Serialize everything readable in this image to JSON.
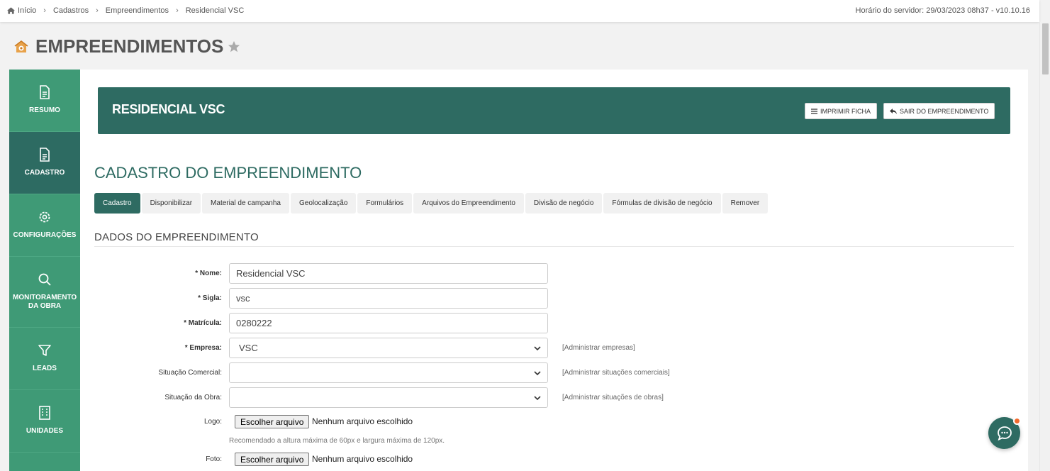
{
  "breadcrumb": {
    "items": [
      "Início",
      "Cadastros",
      "Empreendimentos",
      "Residencial VSC"
    ]
  },
  "server_time": "Horário do servidor: 29/03/2023 08h37 - v10.10.16",
  "page": {
    "title": "EMPREENDIMENTOS",
    "icons": {
      "title": "building-gear-icon",
      "favorite": "star-icon"
    }
  },
  "sidebar": {
    "items": [
      {
        "label": "RESUMO",
        "icon": "document-icon",
        "active": false
      },
      {
        "label": "CADASTRO",
        "icon": "document-icon",
        "active": true
      },
      {
        "label": "CONFIGURAÇÕES",
        "icon": "gear-icon",
        "active": false
      },
      {
        "label": "MONITORAMENTO DA OBRA",
        "icon": "search-icon",
        "active": false
      },
      {
        "label": "LEADS",
        "icon": "filter-icon",
        "active": false
      },
      {
        "label": "UNIDADES",
        "icon": "building-icon",
        "active": false
      }
    ]
  },
  "header": {
    "title": "RESIDENCIAL VSC",
    "print_label": "IMPRIMIR FICHA",
    "exit_label": "SAIR DO EMPREENDIMENTO"
  },
  "section": {
    "title": "CADASTRO DO EMPREENDIMENTO",
    "subsection": "DADOS DO EMPREENDIMENTO"
  },
  "tabs": [
    {
      "label": "Cadastro",
      "active": true
    },
    {
      "label": "Disponibilizar",
      "active": false
    },
    {
      "label": "Material de campanha",
      "active": false
    },
    {
      "label": "Geolocalização",
      "active": false
    },
    {
      "label": "Formulários",
      "active": false
    },
    {
      "label": "Arquivos do Empreendimento",
      "active": false
    },
    {
      "label": "Divisão de negócio",
      "active": false
    },
    {
      "label": "Fórmulas de divisão de negócio",
      "active": false
    },
    {
      "label": "Remover",
      "active": false
    }
  ],
  "form": {
    "nome": {
      "label": "* Nome:",
      "value": "Residencial VSC"
    },
    "sigla": {
      "label": "* Sigla:",
      "value": "vsc"
    },
    "matricula": {
      "label": "* Matrícula:",
      "value": "0280222"
    },
    "empresa": {
      "label": "* Empresa:",
      "value": "VSC",
      "link": "[Administrar empresas]"
    },
    "situacao_comercial": {
      "label": "Situação Comercial:",
      "value": "",
      "link": "[Administrar situações comerciais]"
    },
    "situacao_obra": {
      "label": "Situação da Obra:",
      "value": "",
      "link": "[Administrar situações de obras]"
    },
    "logo": {
      "label": "Logo:",
      "button": "Escolher arquivo",
      "status": "Nenhum arquivo escolhido",
      "hint": "Recomendado a altura máxima de 60px e largura máxima de 120px."
    },
    "foto": {
      "label": "Foto:",
      "button": "Escolher arquivo",
      "status": "Nenhum arquivo escolhido"
    }
  },
  "colors": {
    "sidebar": "#3f9a76",
    "sidebar_active": "#2d6b62",
    "header_card": "#2e6b62",
    "accent_dot": "#f26a2d"
  }
}
